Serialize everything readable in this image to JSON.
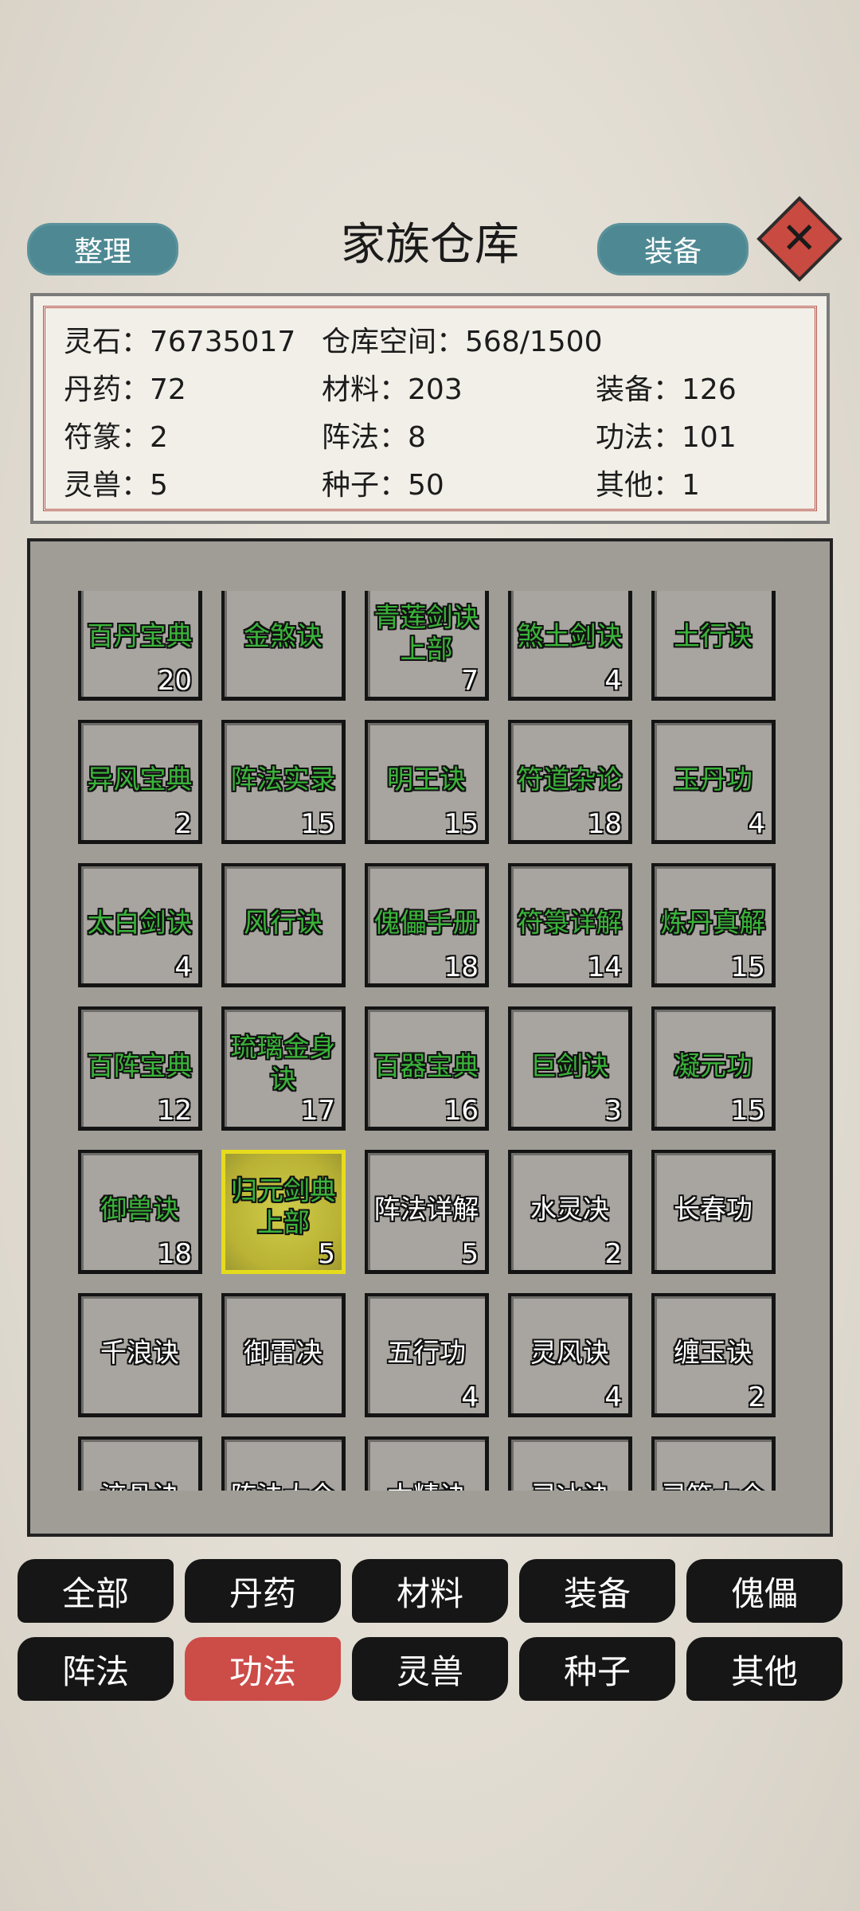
{
  "header": {
    "title": "家族仓库",
    "sort_label": "整理",
    "equip_label": "装备",
    "close_glyph": "✕"
  },
  "stats": {
    "spirit_stone": {
      "label": "灵石",
      "value": "76735017"
    },
    "space": {
      "label": "仓库空间",
      "value": "568/1500"
    },
    "pills": {
      "label": "丹药",
      "value": "72"
    },
    "materials": {
      "label": "材料",
      "value": "203"
    },
    "equipment": {
      "label": "装备",
      "value": "126"
    },
    "talismans": {
      "label": "符篆",
      "value": "2"
    },
    "formations": {
      "label": "阵法",
      "value": "8"
    },
    "techniques": {
      "label": "功法",
      "value": "101"
    },
    "beasts": {
      "label": "灵兽",
      "value": "5"
    },
    "seeds": {
      "label": "种子",
      "value": "50"
    },
    "other": {
      "label": "其他",
      "value": "1"
    }
  },
  "items": [
    {
      "name": "百丹宝典",
      "count": "20",
      "color": "green"
    },
    {
      "name": "金煞诀",
      "count": "",
      "color": "green"
    },
    {
      "name": "青莲剑诀上部",
      "count": "7",
      "color": "green"
    },
    {
      "name": "煞土剑诀",
      "count": "4",
      "color": "green"
    },
    {
      "name": "土行诀",
      "count": "",
      "color": "green"
    },
    {
      "name": "异风宝典",
      "count": "2",
      "color": "green"
    },
    {
      "name": "阵法实录",
      "count": "15",
      "color": "green"
    },
    {
      "name": "明王诀",
      "count": "15",
      "color": "green"
    },
    {
      "name": "符道杂论",
      "count": "18",
      "color": "green"
    },
    {
      "name": "玉丹功",
      "count": "4",
      "color": "green"
    },
    {
      "name": "太白剑诀",
      "count": "4",
      "color": "green"
    },
    {
      "name": "风行诀",
      "count": "",
      "color": "green"
    },
    {
      "name": "傀儡手册",
      "count": "18",
      "color": "green"
    },
    {
      "name": "符箓详解",
      "count": "14",
      "color": "green"
    },
    {
      "name": "炼丹真解",
      "count": "15",
      "color": "green"
    },
    {
      "name": "百阵宝典",
      "count": "12",
      "color": "green"
    },
    {
      "name": "琉璃金身诀",
      "count": "17",
      "color": "green"
    },
    {
      "name": "百器宝典",
      "count": "16",
      "color": "green"
    },
    {
      "name": "巨剑诀",
      "count": "3",
      "color": "green"
    },
    {
      "name": "凝元功",
      "count": "15",
      "color": "green"
    },
    {
      "name": "御兽诀",
      "count": "18",
      "color": "green"
    },
    {
      "name": "归元剑典上部",
      "count": "5",
      "color": "green",
      "selected": true
    },
    {
      "name": "阵法详解",
      "count": "5",
      "color": "white"
    },
    {
      "name": "水灵决",
      "count": "2",
      "color": "white"
    },
    {
      "name": "长春功",
      "count": "",
      "color": "white"
    },
    {
      "name": "千浪诀",
      "count": "",
      "color": "white"
    },
    {
      "name": "御雷决",
      "count": "",
      "color": "white"
    },
    {
      "name": "五行功",
      "count": "4",
      "color": "white"
    },
    {
      "name": "灵风诀",
      "count": "4",
      "color": "white"
    },
    {
      "name": "缠玉诀",
      "count": "2",
      "color": "white"
    },
    {
      "name": "淬骨诀",
      "count": "",
      "color": "white"
    },
    {
      "name": "阵法大全",
      "count": "",
      "color": "white"
    },
    {
      "name": "木精诀",
      "count": "",
      "color": "white"
    },
    {
      "name": "灵冰诀",
      "count": "",
      "color": "white"
    },
    {
      "name": "灵符大全",
      "count": "",
      "color": "white"
    }
  ],
  "tabs": [
    {
      "label": "全部",
      "active": false
    },
    {
      "label": "丹药",
      "active": false
    },
    {
      "label": "材料",
      "active": false
    },
    {
      "label": "装备",
      "active": false
    },
    {
      "label": "傀儡",
      "active": false
    },
    {
      "label": "阵法",
      "active": false
    },
    {
      "label": "功法",
      "active": true
    },
    {
      "label": "灵兽",
      "active": false
    },
    {
      "label": "种子",
      "active": false
    },
    {
      "label": "其他",
      "active": false
    }
  ],
  "colors": {
    "teal_button": "#4e8993",
    "active_tab": "#cc4c48",
    "selected_item": "#d6cf28",
    "item_green_text": "#3ab43a"
  }
}
